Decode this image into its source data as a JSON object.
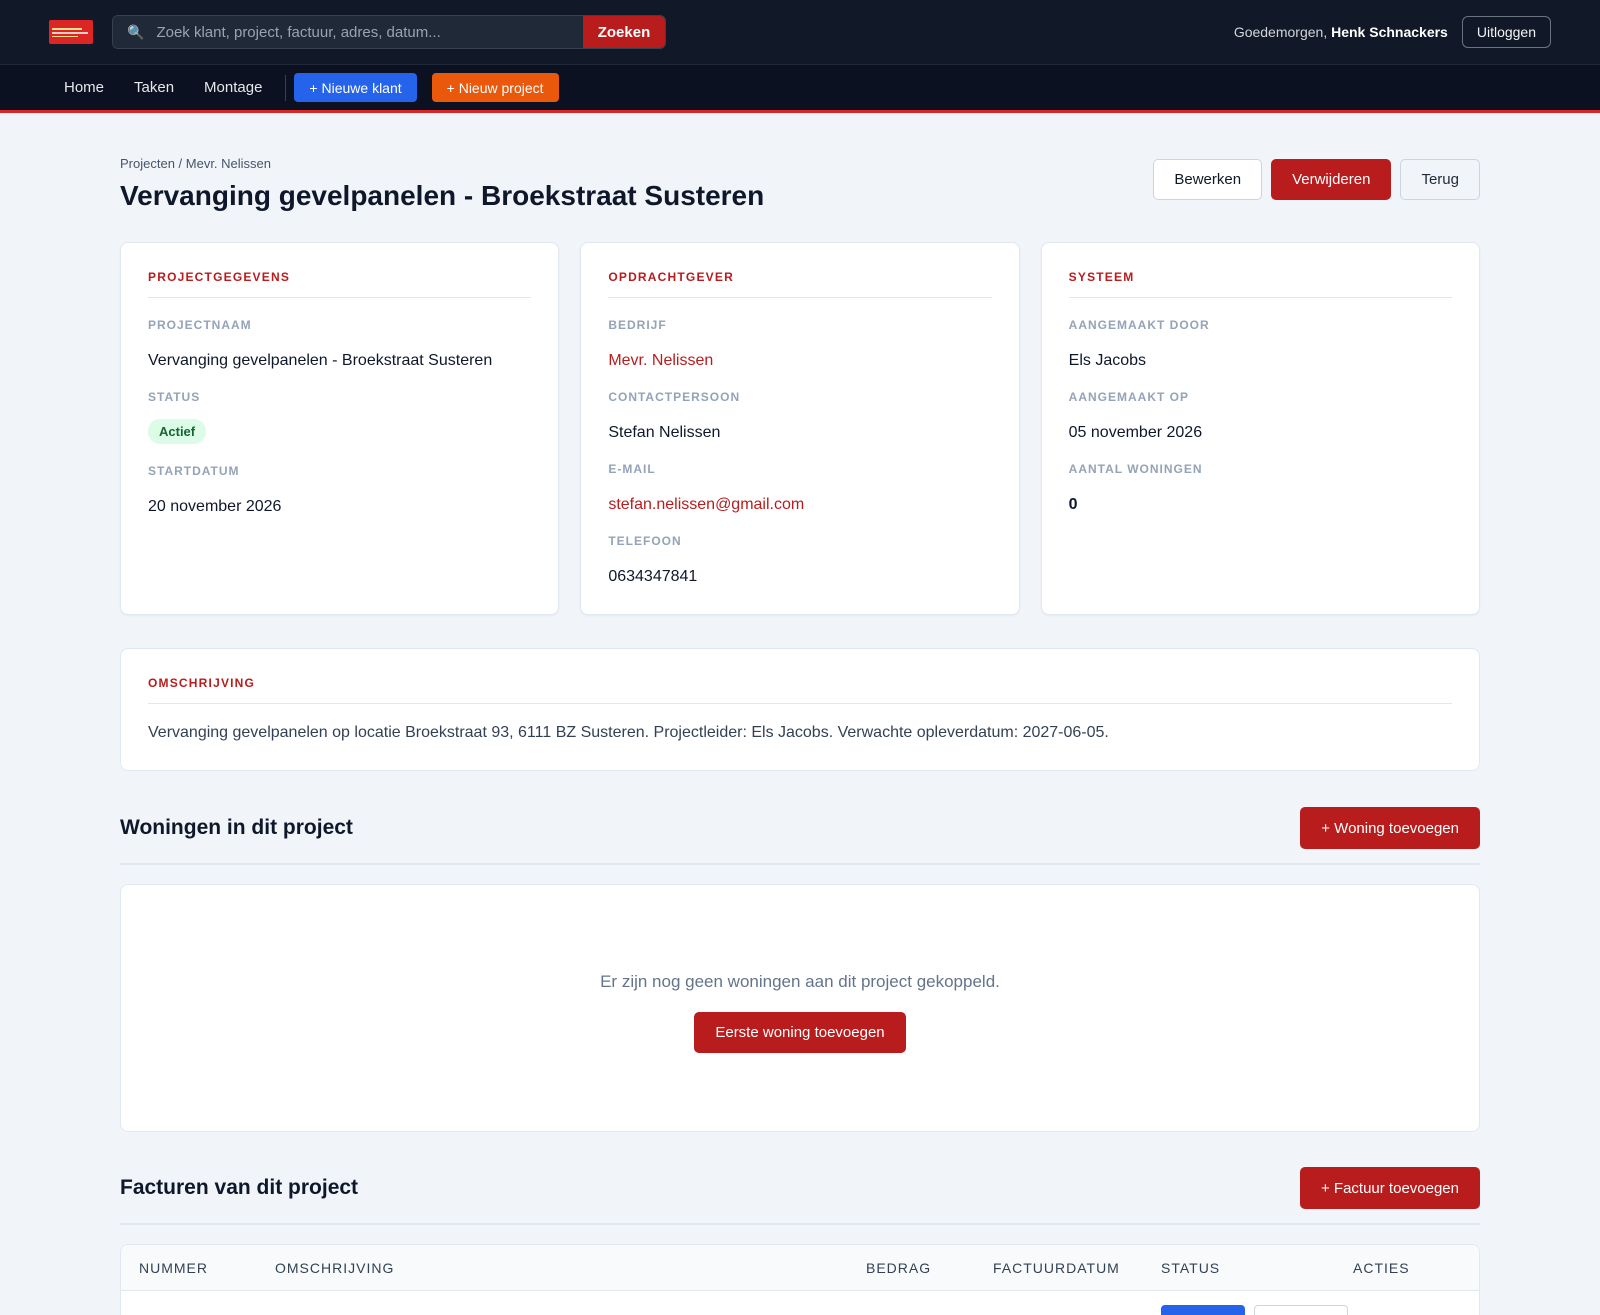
{
  "header": {
    "search_placeholder": "Zoek klant, project, factuur, adres, datum...",
    "search_button": "Zoeken",
    "greeting_prefix": "Goedemorgen,",
    "user_name": "Henk Schnackers",
    "logout_label": "Uitloggen"
  },
  "nav": {
    "home": "Home",
    "tasks": "Taken",
    "assembly": "Montage",
    "new_customer": "+ Nieuwe klant",
    "new_project": "+ Nieuw project"
  },
  "page": {
    "breadcrumb": "Projecten / Mevr. Nelissen",
    "title": "Vervanging gevelpanelen - Broekstraat Susteren",
    "edit_label": "Bewerken",
    "delete_label": "Verwijderen",
    "back_label": "Terug"
  },
  "project_card": {
    "title": "PROJECTGEGEVENS",
    "name_label": "PROJECTNAAM",
    "name_value": "Vervanging gevelpanelen - Broekstraat Susteren",
    "status_label": "STATUS",
    "status_value": "Actief",
    "start_label": "STARTDATUM",
    "start_value": "20 november 2026"
  },
  "client_card": {
    "title": "OPDRACHTGEVER",
    "company_label": "BEDRIJF",
    "company_value": "Mevr. Nelissen",
    "contact_label": "CONTACTPERSOON",
    "contact_value": "Stefan Nelissen",
    "email_label": "E-MAIL",
    "email_value": "stefan.nelissen@gmail.com",
    "phone_label": "TELEFOON",
    "phone_value": "0634347841"
  },
  "system_card": {
    "title": "SYSTEEM",
    "created_by_label": "AANGEMAAKT DOOR",
    "created_by_value": "Els Jacobs",
    "created_on_label": "AANGEMAAKT OP",
    "created_on_value": "05 november 2026",
    "homes_label": "AANTAL WONINGEN",
    "homes_value": "0"
  },
  "description": {
    "title": "OMSCHRIJVING",
    "text": "Vervanging gevelpanelen op locatie Broekstraat 93, 6111 BZ Susteren. Projectleider: Els Jacobs. Verwachte opleverdatum: 2027-06-05."
  },
  "homes_section": {
    "title": "Woningen in dit project",
    "add_label": "+ Woning toevoegen",
    "empty_text": "Er zijn nog geen woningen aan dit project gekoppeld.",
    "first_add_label": "Eerste woning toevoegen"
  },
  "invoices_section": {
    "title": "Facturen van dit project",
    "add_label": "+ Factuur toevoegen",
    "columns": [
      "NUMMER",
      "OMSCHRIJVING",
      "BEDRAG",
      "FACTUURDATUM",
      "STATUS",
      "ACTIES"
    ]
  },
  "colors": {
    "accent_red": "#b91c1c",
    "nav_blue": "#2563eb",
    "nav_orange": "#ea580c",
    "header_dark": "#111827"
  }
}
